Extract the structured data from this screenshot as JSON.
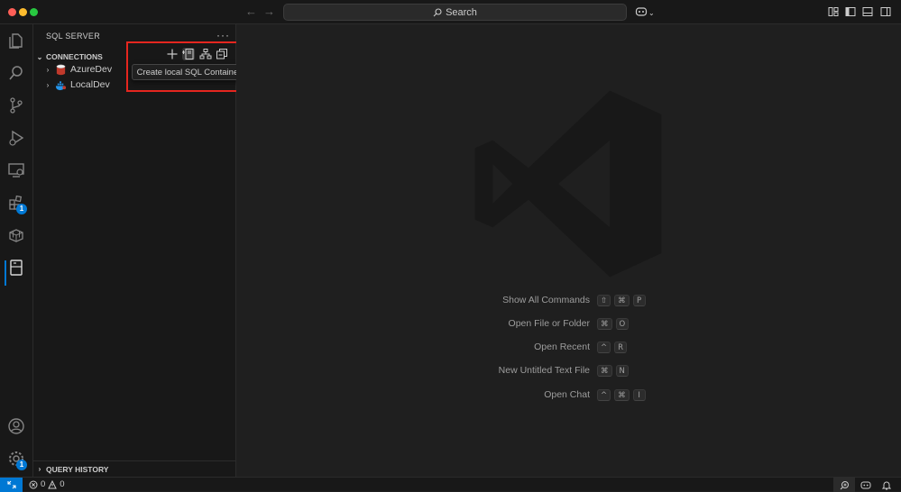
{
  "titlebar": {
    "search_label": "Search"
  },
  "activity": {
    "extensions_badge": "1",
    "settings_badge": "1"
  },
  "sidebar": {
    "title": "SQL SERVER",
    "more_label": "···",
    "connections_label": "CONNECTIONS",
    "connections": [
      {
        "label": "AzureDev",
        "icon": "azure-sql-database-icon"
      },
      {
        "label": "LocalDev",
        "icon": "docker-container-icon"
      }
    ],
    "tooltip": "Create local SQL Container",
    "query_history_label": "QUERY HISTORY"
  },
  "editor": {
    "shortcuts": [
      {
        "label": "Show All Commands",
        "keys": [
          "⇧",
          "⌘",
          "P"
        ]
      },
      {
        "label": "Open File or Folder",
        "keys": [
          "⌘",
          "O"
        ]
      },
      {
        "label": "Open Recent",
        "keys": [
          "^",
          "R"
        ]
      },
      {
        "label": "New Untitled Text File",
        "keys": [
          "⌘",
          "N"
        ]
      },
      {
        "label": "Open Chat",
        "keys": [
          "^",
          "⌘",
          "I"
        ]
      }
    ]
  },
  "statusbar": {
    "errors": "0",
    "warnings": "0"
  },
  "colors": {
    "accent": "#0078d4",
    "highlight_border": "#e5261f",
    "background": "#1f1f1f",
    "sidebar_bg": "#181818"
  }
}
